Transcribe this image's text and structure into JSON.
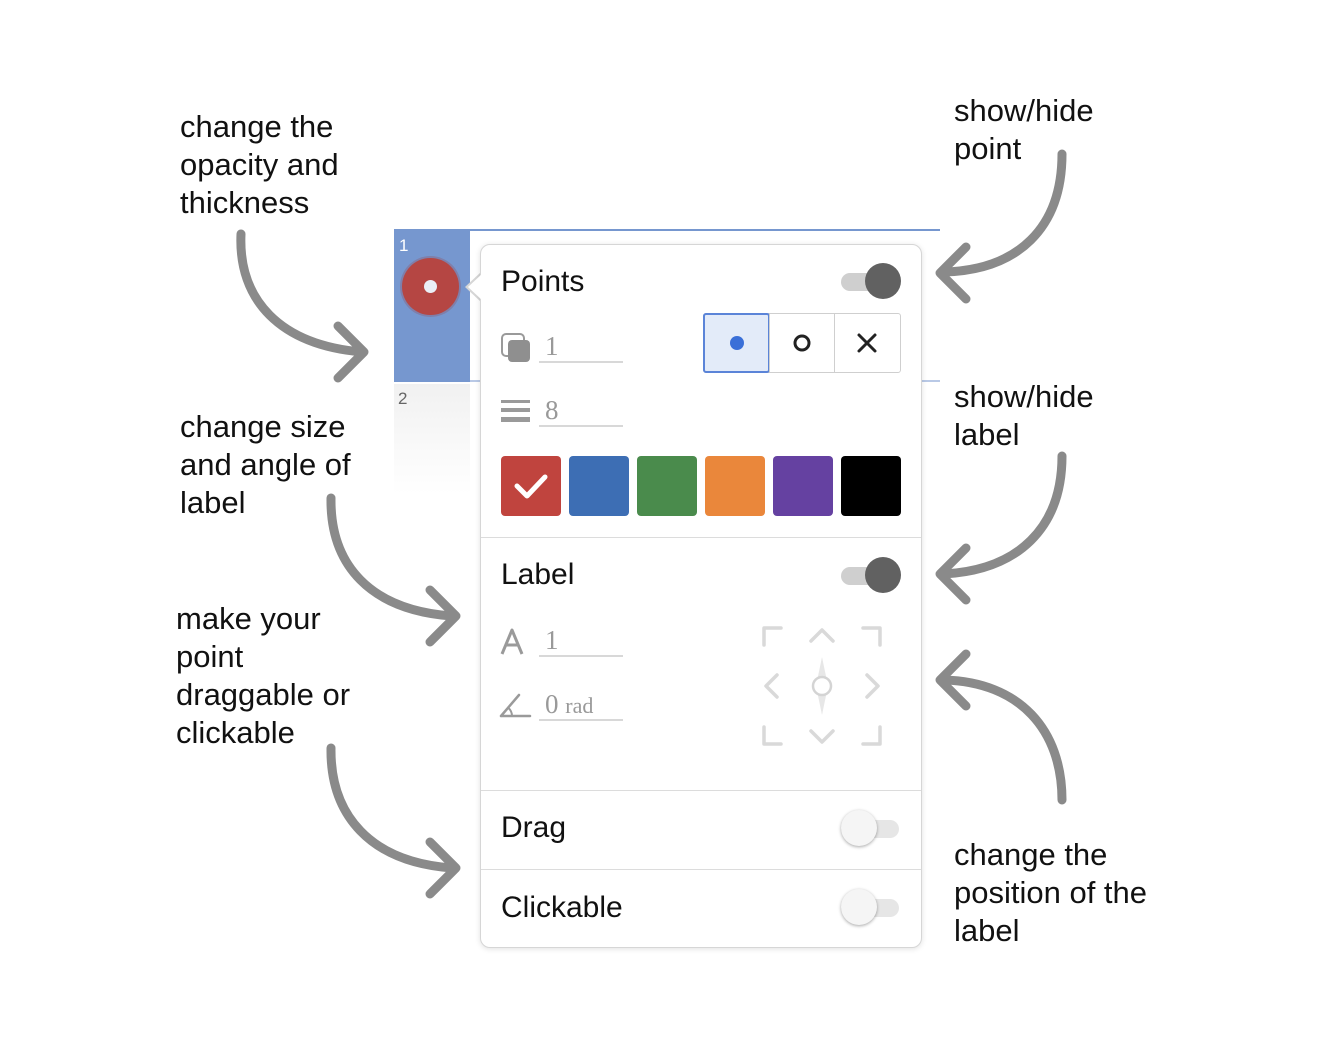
{
  "annotations": {
    "opacity_thickness": "change the\nopacity and\nthickness",
    "size_angle": "change size\nand angle of\nlabel",
    "drag_click": "make your\npoint\ndraggable or\nclickable",
    "show_hide_point": "show/hide\npoint",
    "show_hide_label": "show/hide\nlabel",
    "label_position": "change the\nposition of the\nlabel"
  },
  "expression_list": {
    "row1_number": "1",
    "row2_number": "2",
    "point_color": "#c0392b"
  },
  "panel": {
    "points": {
      "title": "Points",
      "visible": true,
      "opacity_value": "1",
      "thickness_value": "8",
      "styles": [
        "point",
        "open",
        "cross"
      ],
      "selected_style": "point",
      "colors": [
        "#c0443e",
        "#3d6eb4",
        "#4a8b4c",
        "#ea873b",
        "#6541a1",
        "#000000"
      ],
      "selected_color": "#c0443e"
    },
    "label": {
      "title": "Label",
      "visible": true,
      "size_value": "1",
      "angle_value": "0",
      "angle_unit": "rad"
    },
    "drag": {
      "title": "Drag",
      "enabled": false
    },
    "clickable": {
      "title": "Clickable",
      "enabled": false
    }
  },
  "icons": {
    "opacity": "opacity-icon",
    "thickness": "thickness-icon",
    "size": "text-size-icon",
    "angle": "angle-icon",
    "check": "check-icon",
    "position": "label-position-icon"
  }
}
